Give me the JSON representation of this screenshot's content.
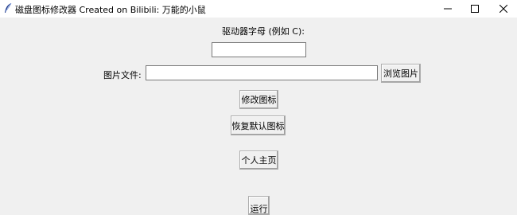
{
  "window": {
    "title": "磁盘图标修改器  Created on Bilibili: 万能的小鼠",
    "icon": "feather-icon"
  },
  "form": {
    "drive_label": "驱动器字母 (例如 C):",
    "drive_value": "",
    "image_label": "图片文件:",
    "image_value": "",
    "browse_button": "浏览图片",
    "modify_button": "修改图标",
    "restore_button": "恢复默认图标",
    "homepage_button": "个人主页",
    "bottom_button": "运行"
  }
}
